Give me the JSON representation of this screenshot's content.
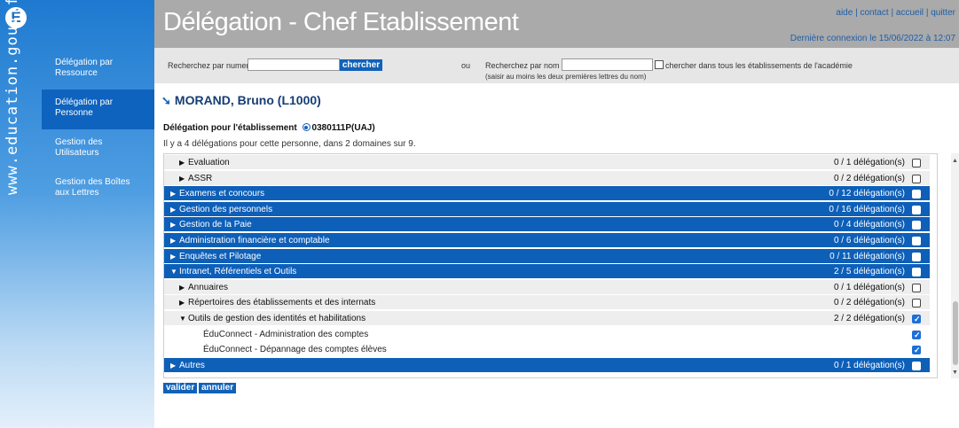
{
  "brand": {
    "logo_glyph": "É",
    "vertical_url": "www.education.gouv.fr"
  },
  "sidebar": {
    "items": [
      {
        "label": "Délégation par Ressource",
        "active": false
      },
      {
        "label": "Délégation par Personne",
        "active": true
      },
      {
        "label": "Gestion des Utilisateurs",
        "active": false
      },
      {
        "label": "Gestion des Boîtes aux Lettres",
        "active": false
      }
    ]
  },
  "header": {
    "title": "Délégation - Chef Etablissement",
    "links": [
      "aide",
      "contact",
      "accueil",
      "quitter"
    ],
    "separator": "|",
    "last_login": "Dernière connexion le 15/06/2022 à 12:07"
  },
  "search": {
    "by_number_label": "Recherchez par numen",
    "by_number_value": "",
    "button_label": "chercher",
    "or_label": "ou",
    "by_name_label": "Recherchez par nom",
    "by_name_value": "",
    "by_name_hint": "(saisir au moins les deux premières lettres du nom)",
    "all_etab_label": "chercher dans tous les établissements de l'académie",
    "all_etab_checked": false
  },
  "person": {
    "name": "MORAND, Bruno (L1000)",
    "etab_label": "Délégation pour l'établissement",
    "etab_value": "0380111P(UAJ)",
    "summary": "Il y a 4 délégations pour cette personne, dans 2 domaines sur 9."
  },
  "tree": {
    "rows": [
      {
        "kind": "sub",
        "expanded": false,
        "label": "Evaluation",
        "count": "0 / 1 délégation(s)",
        "checked": false
      },
      {
        "kind": "sub",
        "expanded": false,
        "label": "ASSR",
        "count": "0 / 2 délégation(s)",
        "checked": false
      },
      {
        "kind": "domain",
        "expanded": false,
        "label": "Examens et concours",
        "count": "0 / 12 délégation(s)",
        "checked": false
      },
      {
        "kind": "domain",
        "expanded": false,
        "label": "Gestion des personnels",
        "count": "0 / 16 délégation(s)",
        "checked": false
      },
      {
        "kind": "domain",
        "expanded": false,
        "label": "Gestion de la Paie",
        "count": "0 / 4 délégation(s)",
        "checked": false
      },
      {
        "kind": "domain",
        "expanded": false,
        "label": "Administration financière et comptable",
        "count": "0 / 6 délégation(s)",
        "checked": false
      },
      {
        "kind": "domain",
        "expanded": false,
        "label": "Enquêtes et Pilotage",
        "count": "0 / 11 délégation(s)",
        "checked": false
      },
      {
        "kind": "domain",
        "expanded": true,
        "label": "Intranet, Référentiels et Outils",
        "count": "2 / 5 délégation(s)",
        "checked": false
      },
      {
        "kind": "sub",
        "expanded": false,
        "label": "Annuaires",
        "count": "0 / 1 délégation(s)",
        "checked": false
      },
      {
        "kind": "sub",
        "expanded": false,
        "label": "Répertoires des établissements et des internats",
        "count": "0 / 2 délégation(s)",
        "checked": false
      },
      {
        "kind": "sub",
        "expanded": true,
        "label": "Outils de gestion des identités et habilitations",
        "count": "2 / 2 délégation(s)",
        "checked": true
      },
      {
        "kind": "leaf",
        "expanded": false,
        "label": "ÉduConnect - Administration des comptes",
        "count": "",
        "checked": true
      },
      {
        "kind": "leaf",
        "expanded": false,
        "label": "ÉduConnect - Dépannage des comptes élèves",
        "count": "",
        "checked": true
      },
      {
        "kind": "domain",
        "expanded": false,
        "label": "Autres",
        "count": "0 / 1 délégation(s)",
        "checked": false
      }
    ]
  },
  "actions": {
    "validate_label": "valider",
    "cancel_label": "annuler"
  },
  "colors": {
    "primary_blue": "#0d5fb8",
    "header_gray": "#aaaaaa",
    "link_blue": "#1e5ea8"
  }
}
